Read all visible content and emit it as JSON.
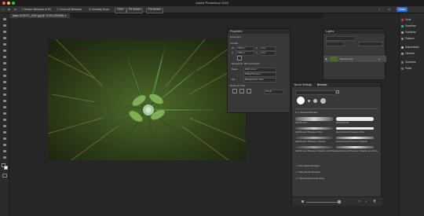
{
  "app": {
    "title": "Adobe Photoshop 2024"
  },
  "options_bar": {
    "items": [
      "Resize Windows to Fit",
      "Zoom All Windows",
      "Scrubby Zoom",
      "100%",
      "Fit Screen",
      "Fill Screen"
    ],
    "share_label": "Share"
  },
  "document_tab": {
    "label": "plant-1075171_1920.jpg @ 75.9% (RGB/8)"
  },
  "properties": {
    "title": "Properties",
    "section_document": "Document",
    "section_canvas": "Canvas",
    "w_label": "W",
    "w_value": "1920 px",
    "h_label": "H",
    "h_value": "1130 px",
    "x_label": "X",
    "y_label": "Y",
    "x_value": "0 px",
    "y_value": "0 px",
    "resolution": "Resolution: 300 pixels/inch",
    "mode_label": "Mode",
    "mode_value": "RGB Color",
    "bits_value": "8 Bits/Channel",
    "fill_label": "Fill",
    "fill_value": "Background Color",
    "rulers_section": "Rulers & Grids",
    "units_value": "Pixels"
  },
  "layers": {
    "title": "Layers",
    "layer_name": "Background"
  },
  "brushes": {
    "tab_settings": "Brush Settings",
    "tab_brushes": "Brushes",
    "folder_general": "General Brushes",
    "b1": "Soft Round",
    "b2": "Hard Round",
    "b3": "Soft Round Pressure Size",
    "b4": "Hard Round Pressure Size",
    "b5": "Soft Round Pressure Opacity",
    "b6": "Hard Round Pressure Opacity",
    "b7": "Soft Round Pressure Opacity and Flow",
    "b8": "Hard Round Pressure Opacity and Flow",
    "folder_dry": "Dry Media Brushes",
    "folder_wet": "Wet Media Brushes",
    "folder_special": "Special Effects Brushes"
  },
  "right_dock": {
    "color": "Color",
    "swatches": "Swatches",
    "gradients": "Gradients",
    "patterns": "Patterns",
    "adjustments": "Adjustments",
    "libraries": "Libraries",
    "channels": "Channels",
    "paths": "Paths"
  },
  "colors": {
    "accent": "#2f6fe0",
    "panel": "#383838",
    "app_bg": "#262626"
  }
}
